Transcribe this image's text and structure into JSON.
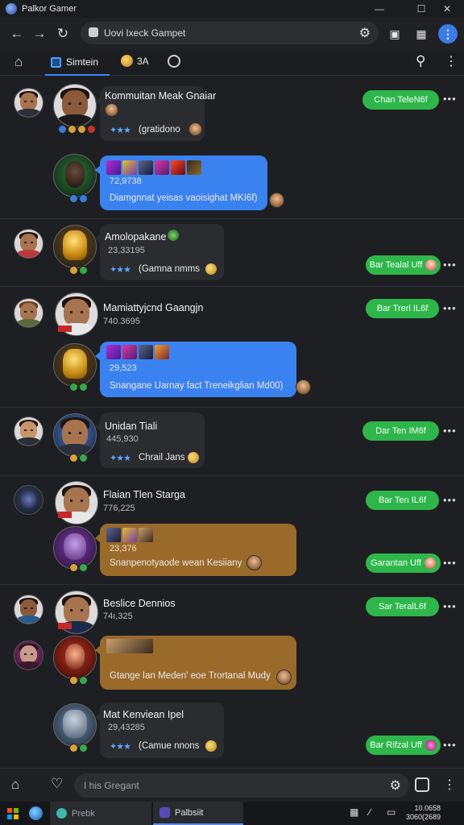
{
  "window": {
    "title": "Palkor Gamer"
  },
  "browser": {
    "url_text": "Uovi Ixeck Gampet"
  },
  "tabs": {
    "active_label": "Simtein",
    "second_label": "3A"
  },
  "feed": [
    {
      "name": "Kommuitan Meak Gnaiar",
      "tag_line": "(gratidono",
      "action_label": "Chan TeleN6f"
    },
    {
      "score": "72,9738",
      "message": "Diamgnnat yeisas vaoisighat MKI6f)"
    },
    {
      "name": "Amolopakane",
      "score": "23,33195",
      "tag_line": "(Gamna nmms",
      "action_label": "Bar Tealal Uff"
    },
    {
      "name": "Mamiattyjcnd Gaangjn",
      "score": "740.3695",
      "action_label": "Bar Trerl IL6f"
    },
    {
      "score": "29,523",
      "message": "Snangane Uarnay fact Treneikglian Md00)"
    },
    {
      "name": "Unidan Tiali",
      "score": "445,930",
      "tag_line": "Chrail Jans",
      "action_label": "Dar Ten IM6f"
    },
    {
      "name": "Flaian Tlen Starga",
      "score": "776,225",
      "action_label": "Bar Ten IL6f"
    },
    {
      "score": "23,376",
      "message": "Snanpenotyaode wean Kesiiany",
      "action_label": "Garantan Uff"
    },
    {
      "name": "Beslice Dennios",
      "score": "74ı,325",
      "action_label": "Sar TeralL6f"
    },
    {
      "message": "Gtange Ian Meden' eoe Trortanal Mudy"
    },
    {
      "name": "Mat Kenviean Ipel",
      "score": "29,43285",
      "tag_line": "(Camue nnons",
      "action_label": "Bar Rifzal Uff"
    }
  ],
  "composer": {
    "placeholder": "I his Gregant"
  },
  "taskbar": {
    "item1": "Prebk",
    "item2": "Palbsiit",
    "clock_time": "10.0658",
    "clock_date": "3060(2689"
  },
  "colors": {
    "accent_blue": "#3b82f1",
    "action_green": "#2fb64b",
    "bubble_brown": "#9a6a2a",
    "background": "#1e1f22"
  }
}
